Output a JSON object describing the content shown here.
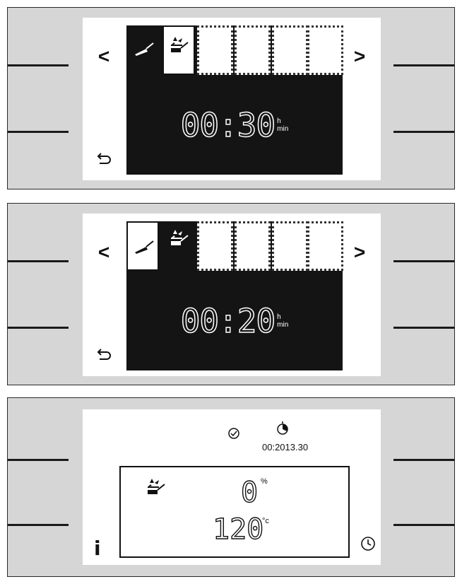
{
  "screens": [
    {
      "nav_prev": "<",
      "nav_next": ">",
      "time_value": "00:30",
      "unit_top": "h",
      "unit_bottom": "min",
      "active_tab": 0
    },
    {
      "nav_prev": "<",
      "nav_next": ">",
      "time_value": "00:20",
      "unit_top": "h",
      "unit_bottom": "min",
      "active_tab": 1
    }
  ],
  "status": {
    "time_readout": "00:2013.30",
    "humidity_value": "0",
    "humidity_unit": "%",
    "temperature_value": "120",
    "temperature_unit": "°c",
    "info_label": "i"
  },
  "icons": {
    "brush": "brush-cleaning-icon",
    "fan_brush": "fan-brush-icon",
    "back": "back-arrow-icon",
    "timer": "timer-icon",
    "duration": "duration-icon",
    "clock": "clock-icon"
  }
}
